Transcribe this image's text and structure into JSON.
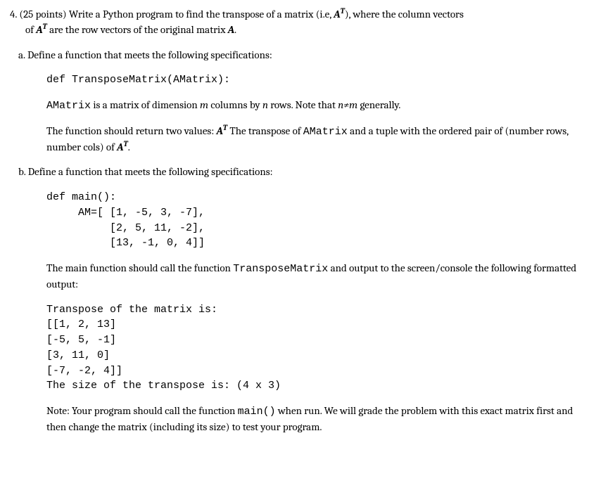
{
  "question": {
    "number": "4.",
    "points": "(25 points)",
    "prompt_a": "  Write a Python program to find the transpose of a matrix (i.e, ",
    "AT1": "A",
    "Tsup1": "T",
    "prompt_b": "), where the column vectors",
    "prompt_line2a": "of ",
    "AT2": "A",
    "Tsup2": "T",
    "prompt_line2b": " are the row vectors of the original matrix ",
    "Aonly": "A",
    "period": "."
  },
  "part_a": {
    "label": "a. Define a function that meets the following specifications:",
    "fnsig": "def TransposeMatrix(AMatrix):",
    "desc1a": "AMatrix",
    "desc1b": " is a matrix of dimension ",
    "m": "m",
    "desc1c": " columns by ",
    "n": "n",
    "desc1d": " rows.  Note that ",
    "nneqm": "n≠m",
    "desc1e": " generally.",
    "desc2a": "The function should return two values:  ",
    "AT": "A",
    "Tsup": "T",
    "desc2b": " The transpose of ",
    "amatrix2": "AMatrix",
    "desc2c": "  and a tuple with the ordered pair of (number rows, number cols) of ",
    "AT2": "A",
    "Tsup2": "T",
    "desc2d": "."
  },
  "part_b": {
    "label": "b. Define a function that meets the following specifications:",
    "code": "def main():\n     AM=[ [1, -5, 3, -7],\n          [2, 5, 11, -2],\n          [13, -1, 0, 4]]",
    "desc_a": "The main function should call the function ",
    "fnname": "TransposeMatrix",
    "desc_b": " and output to the screen/console the following formatted output:",
    "output": "Transpose of the matrix is:\n[[1, 2, 13]\n[-5, 5, -1]\n[3, 11, 0]\n[-7, -2, 4]]\nThe size of the transpose is: (4 x 3)",
    "note_a": "Note:  Your program should call the function ",
    "mainfn": "main()",
    "note_b": " when run.  We will grade the problem with this exact matrix first and then change the matrix (including its size) to test your program."
  },
  "chart_data": {
    "type": "table",
    "title": "Matrix AM and its transpose",
    "original_matrix": [
      [
        1,
        -5,
        3,
        -7
      ],
      [
        2,
        5,
        11,
        -2
      ],
      [
        13,
        -1,
        0,
        4
      ]
    ],
    "original_shape": {
      "rows": 3,
      "cols": 4
    },
    "transpose_matrix": [
      [
        1,
        2,
        13
      ],
      [
        -5,
        5,
        -1
      ],
      [
        3,
        11,
        0
      ],
      [
        -7,
        -2,
        4
      ]
    ],
    "transpose_shape": {
      "rows": 4,
      "cols": 3
    }
  }
}
